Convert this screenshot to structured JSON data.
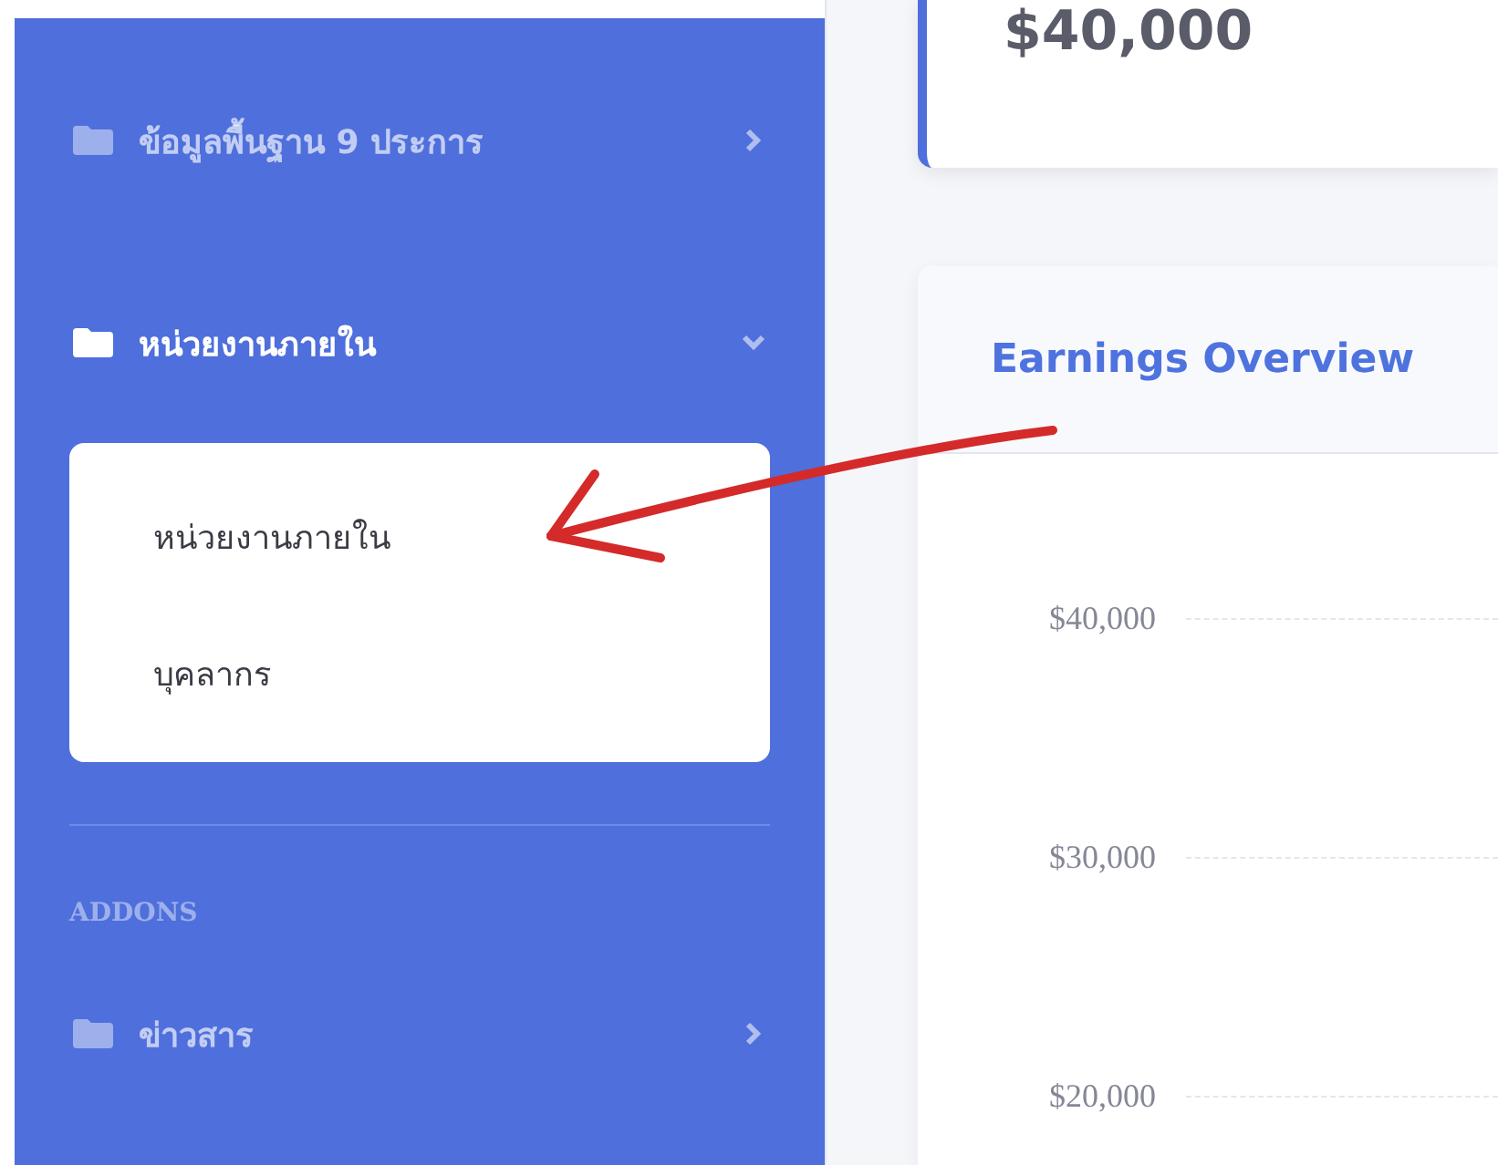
{
  "sidebar": {
    "items": [
      {
        "label": "ข้อมูลพื้นฐาน 9 ประการ",
        "expanded": false
      },
      {
        "label": "หน่วยงานภายใน",
        "expanded": true,
        "children": [
          {
            "label": "หน่วยงานภายใน"
          },
          {
            "label": "บุคลากร"
          }
        ]
      }
    ],
    "heading": "ADDONS",
    "addon_items": [
      {
        "label": "ข่าวสาร",
        "expanded": false
      }
    ]
  },
  "stat_card": {
    "value": "$40,000"
  },
  "earnings_card": {
    "title": "Earnings Overview",
    "y_tick_labels": [
      "$40,000",
      "$30,000",
      "$20,000"
    ]
  }
}
